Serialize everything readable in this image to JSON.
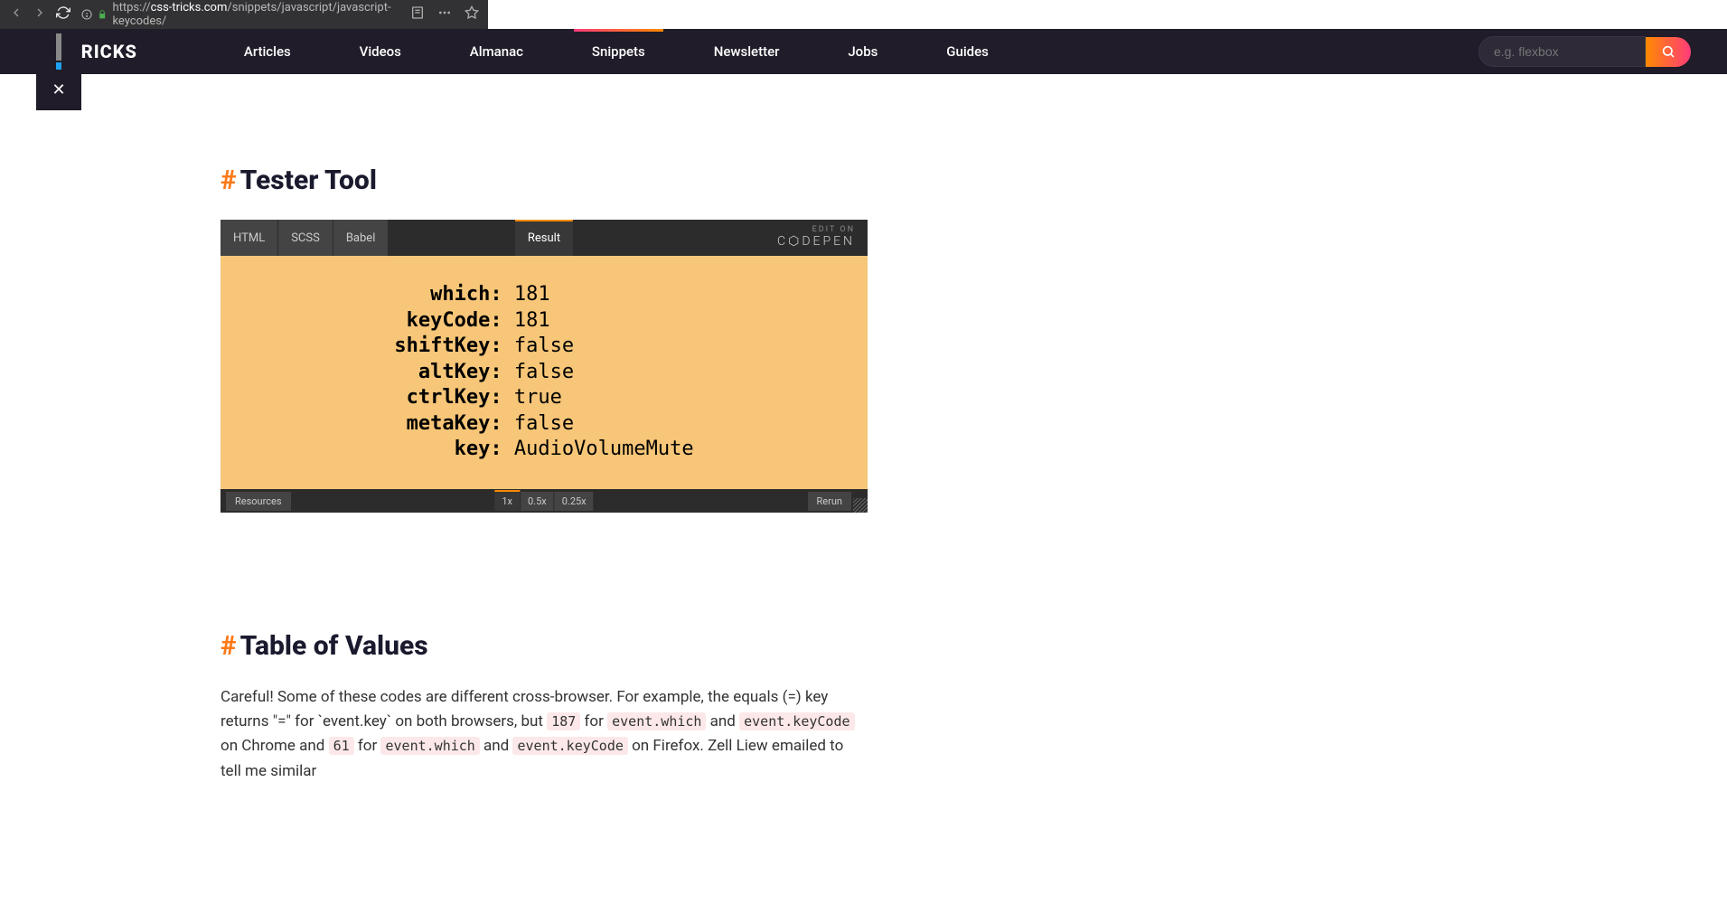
{
  "browser": {
    "url_prefix": "https://",
    "url_domain": "css-tricks.com",
    "url_path": "/snippets/javascript/javascript-keycodes/"
  },
  "logo": "SS-TRICKS",
  "nav": [
    "Articles",
    "Videos",
    "Almanac",
    "Snippets",
    "Newsletter",
    "Jobs",
    "Guides"
  ],
  "active_nav": 3,
  "search": {
    "placeholder": "e.g. flexbox"
  },
  "sections": {
    "tester": {
      "hash": "#",
      "title": "Tester Tool"
    },
    "table": {
      "hash": "#",
      "title": "Table of Values"
    }
  },
  "codepen": {
    "tabs_left": [
      "HTML",
      "SCSS",
      "Babel"
    ],
    "tab_center": "Result",
    "edit_label": "EDIT ON",
    "logo": "C⬡DEPEN",
    "output": [
      {
        "k": "which",
        "v": "181"
      },
      {
        "k": "keyCode",
        "v": "181"
      },
      {
        "k": "shiftKey",
        "v": "false"
      },
      {
        "k": "altKey",
        "v": "false"
      },
      {
        "k": "ctrlKey",
        "v": "true"
      },
      {
        "k": "metaKey",
        "v": "false"
      },
      {
        "k": "key",
        "v": "AudioVolumeMute"
      }
    ],
    "resources": "Resources",
    "zoom": [
      "1x",
      "0.5x",
      "0.25x"
    ],
    "rerun": "Rerun"
  },
  "paragraph": {
    "p1": "Careful! Some of these codes are different cross-browser. For example, the equals (=) key returns \"=\" for `event.key` on both browsers, but ",
    "c1": "187",
    "p2": " for ",
    "c2": "event.which",
    "p3": " and ",
    "c3": "event.keyCode",
    "p4": " on Chrome and ",
    "c4": "61",
    "p5": " for ",
    "c5": "event.which",
    "p6": " and ",
    "c6": "event.keyCode",
    "p7": " on Firefox. Zell Liew emailed to tell me similar"
  }
}
